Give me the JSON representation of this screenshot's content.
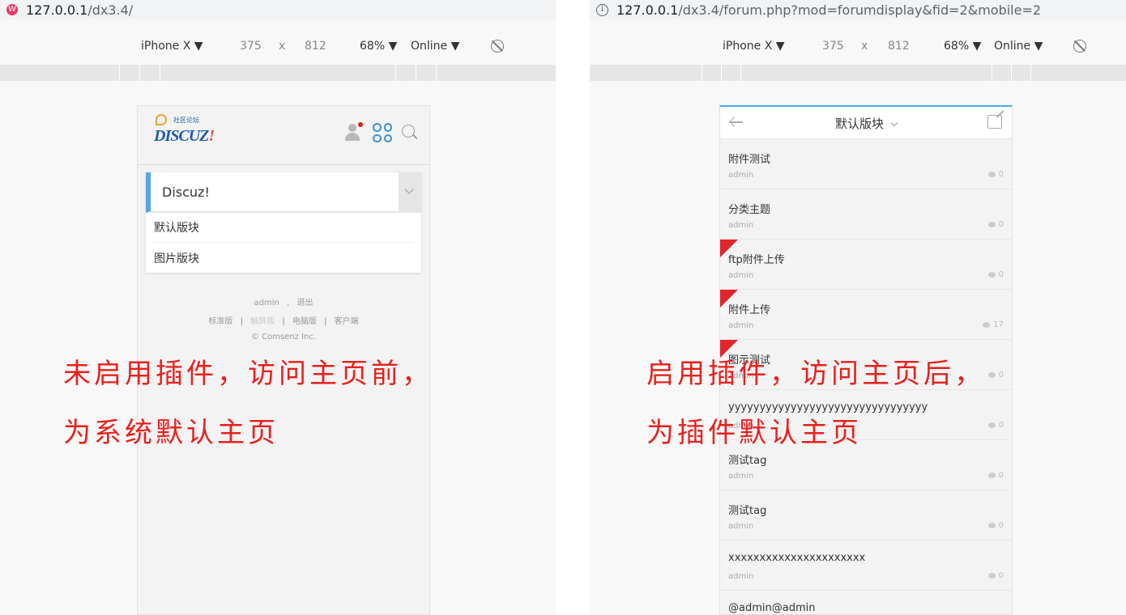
{
  "left": {
    "address": {
      "host": "127.0.0.1",
      "path": "/dx3.4/"
    },
    "favicon_char": "W",
    "device": {
      "name": "iPhone X ▼",
      "width": "375",
      "x": "x",
      "height": "812",
      "zoom": "68% ▼",
      "network": "Online ▼"
    },
    "logo": {
      "cn": "社区论坛",
      "en": "DISCUZ",
      "mark": "!"
    },
    "menu": {
      "selected": "Discuz!",
      "options": [
        "默认版块",
        "图片版块"
      ]
    },
    "footer": {
      "user": "admin",
      "comma": ",",
      "logout": "退出",
      "links": [
        "标准版",
        "触屏版",
        "电脑版",
        "客户端"
      ],
      "sep": "|",
      "copyright": "© Comsenz Inc."
    },
    "annotation": {
      "line1": "未启用插件，访问主页前，",
      "line2": "为系统默认主页"
    }
  },
  "right": {
    "address": {
      "host": "127.0.0.1",
      "path": "/dx3.4/forum.php?mod=forumdisplay&fid=2&mobile=2"
    },
    "info_char": "i",
    "device": {
      "name": "iPhone X ▼",
      "width": "375",
      "x": "x",
      "height": "812",
      "zoom": "68% ▼",
      "network": "Online ▼"
    },
    "topbar": {
      "title": "默认版块"
    },
    "flag_char": "图",
    "threads": [
      {
        "title": "附件测试",
        "author": "admin",
        "replies": "0",
        "flag": false
      },
      {
        "title": "分类主题",
        "author": "admin",
        "replies": "0",
        "flag": false
      },
      {
        "title": "ftp附件上传",
        "author": "admin",
        "replies": "0",
        "flag": true
      },
      {
        "title": "附件上传",
        "author": "admin",
        "replies": "17",
        "flag": true
      },
      {
        "title": "图示测试",
        "author": "admin",
        "replies": "0",
        "flag": true
      },
      {
        "title": "yyyyyyyyyyyyyyyyyyyyyyyyyyyyyyyy",
        "author": "admin",
        "replies": "0",
        "flag": false
      },
      {
        "title": "测试tag",
        "author": "admin",
        "replies": "0",
        "flag": false
      },
      {
        "title": "测试tag",
        "author": "admin",
        "replies": "0",
        "flag": false
      },
      {
        "title": "xxxxxxxxxxxxxxxxxxxxxx",
        "author": "admin",
        "replies": "0",
        "flag": false
      },
      {
        "title": "@admin@admin",
        "author": "",
        "replies": "",
        "flag": false
      }
    ],
    "annotation": {
      "line1": "启用插件，访问主页后，",
      "line2": "为插件默认主页"
    }
  },
  "colors": {
    "annotation": "#e8201c",
    "accent_blue": "#57a6e0",
    "flag_red": "#e0252b"
  }
}
